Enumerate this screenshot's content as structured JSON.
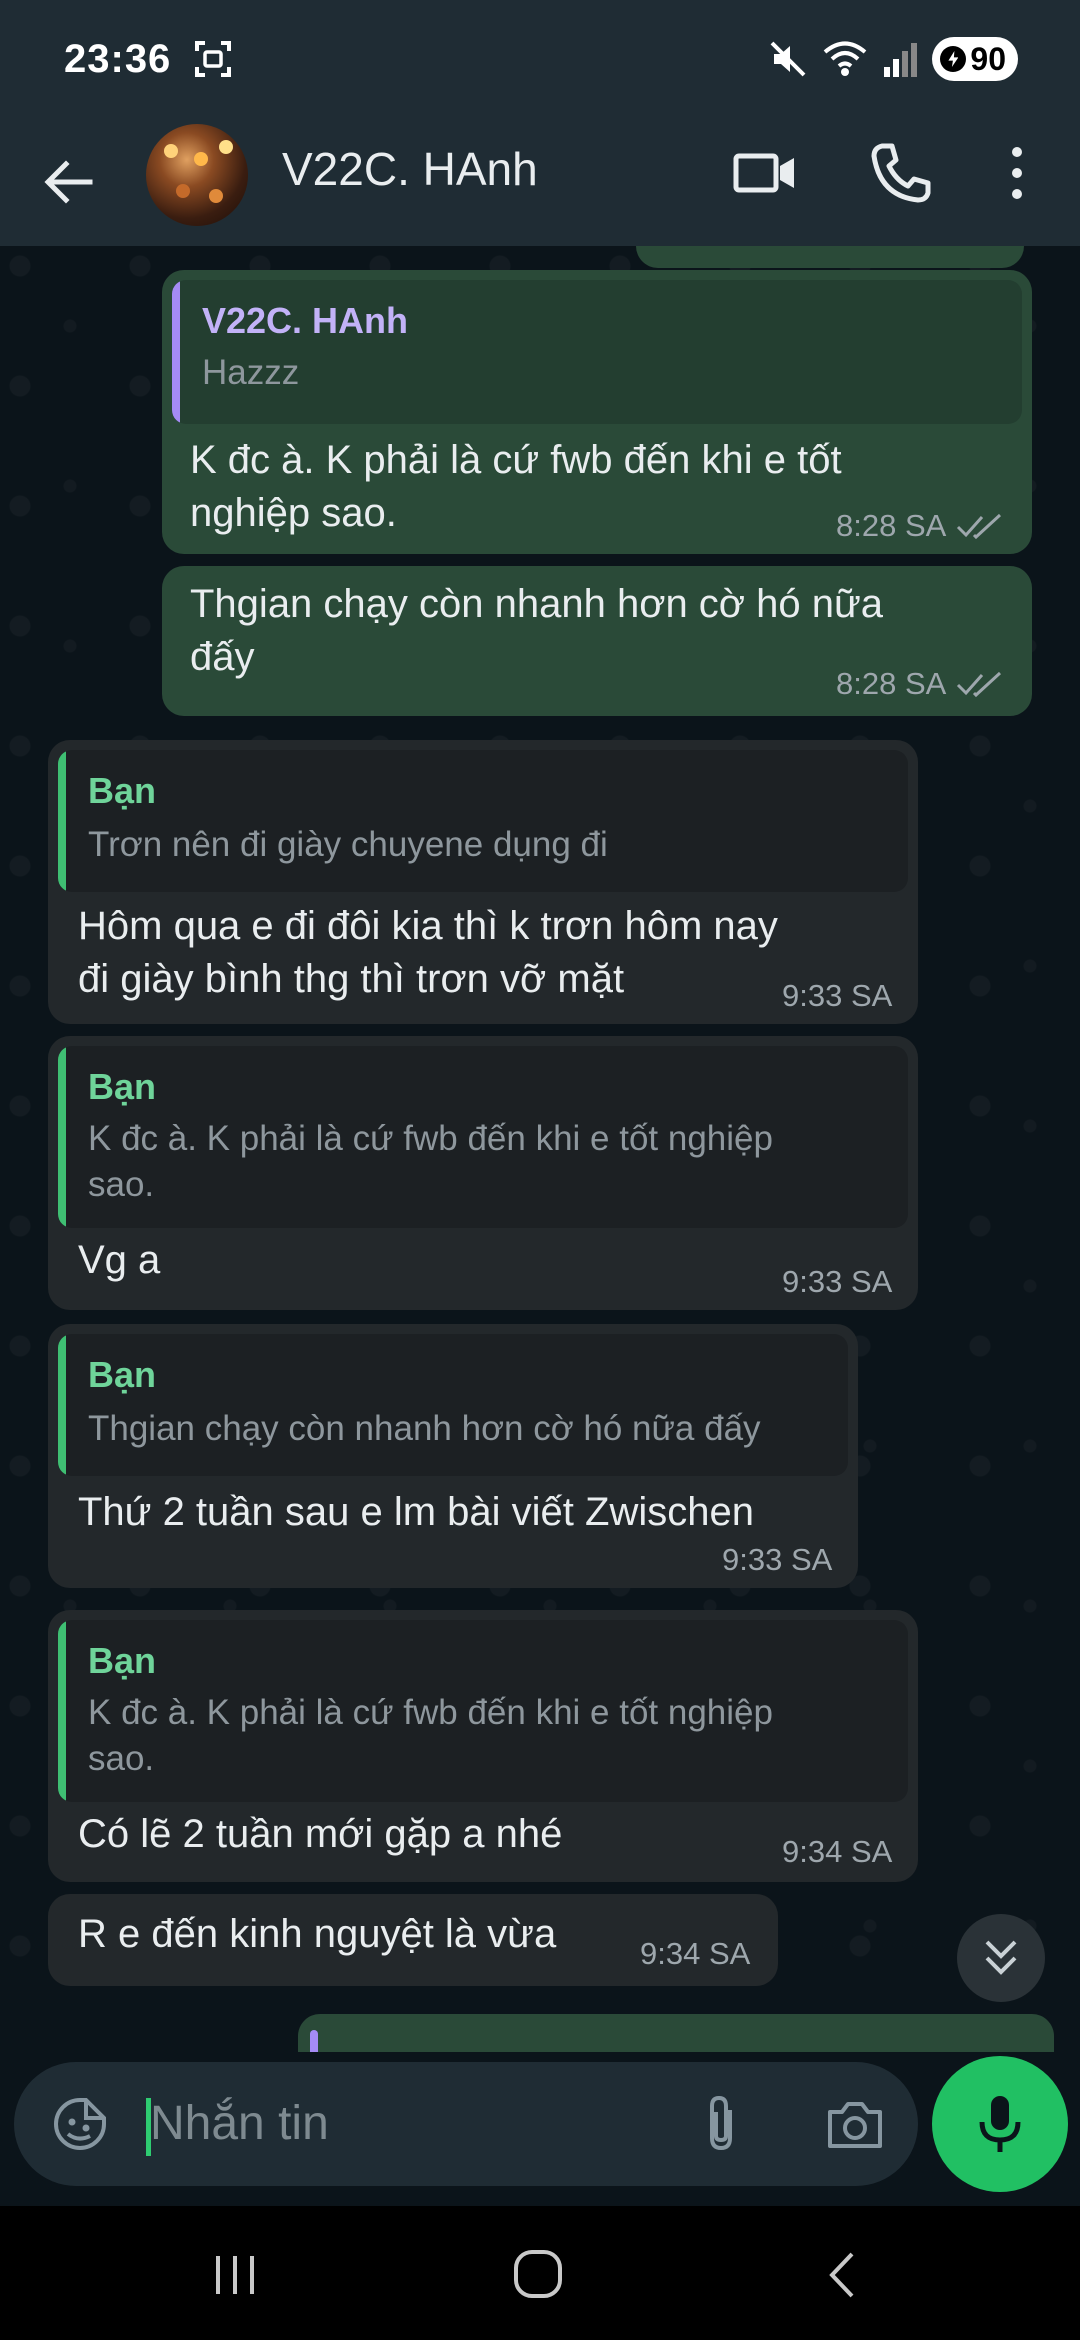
{
  "status_bar": {
    "time": "23:36",
    "battery": "90"
  },
  "header": {
    "contact_name": "V22C. HAnh"
  },
  "messages": [
    {
      "direction": "out",
      "quote_name": "V22C. HAnh",
      "quote_text": "Hazzz",
      "text_lines": [
        "K đc à. K phải là cứ fwb đến khi e tốt",
        "nghiệp sao."
      ],
      "time": "8:28 SA"
    },
    {
      "direction": "out",
      "text_lines": [
        "Thgian chạy còn nhanh hơn cờ hó nữa",
        "đấy"
      ],
      "time": "8:28 SA"
    },
    {
      "direction": "in",
      "quote_name": "Bạn",
      "quote_text": "Trơn nên đi giày chuyene dụng đi",
      "text_lines": [
        "Hôm qua e đi đôi kia thì k trơn hôm nay",
        "đi giày bình thg thì trơn vỡ mặt"
      ],
      "time": "9:33 SA"
    },
    {
      "direction": "in",
      "quote_name": "Bạn",
      "quote_text_lines": [
        "K đc à. K phải là cứ fwb đến khi e tốt nghiệp",
        "sao."
      ],
      "text_lines": [
        "Vg a"
      ],
      "time": "9:33 SA"
    },
    {
      "direction": "in",
      "quote_name": "Bạn",
      "quote_text": "Thgian chạy còn nhanh hơn cờ hó nữa đấy",
      "text_lines": [
        "Thứ 2 tuần sau e lm bài viết Zwischen"
      ],
      "time": "9:33 SA"
    },
    {
      "direction": "in",
      "quote_name": "Bạn",
      "quote_text_lines": [
        "K đc à. K phải là cứ fwb đến khi e tốt nghiệp",
        "sao."
      ],
      "text_lines": [
        "Có lẽ 2 tuần mới gặp a nhé"
      ],
      "time": "9:34 SA"
    },
    {
      "direction": "in",
      "text_lines": [
        "R e đến kinh nguyệt là vừa"
      ],
      "time": "9:34 SA"
    }
  ],
  "composer": {
    "placeholder": "Nhắn tin"
  },
  "icons": {
    "back": "arrow-left-icon",
    "video": "video-call-icon",
    "call": "phone-icon",
    "more": "more-vert-icon",
    "emoji": "sticker-icon",
    "attach": "paperclip-icon",
    "camera": "camera-icon",
    "mic": "mic-icon",
    "scroll": "double-chevron-down-icon",
    "read": "double-check-icon"
  },
  "colors": {
    "accent": "#21c063",
    "outgoing_bubble": "#2a4a38",
    "incoming_bubble": "#23282b"
  }
}
